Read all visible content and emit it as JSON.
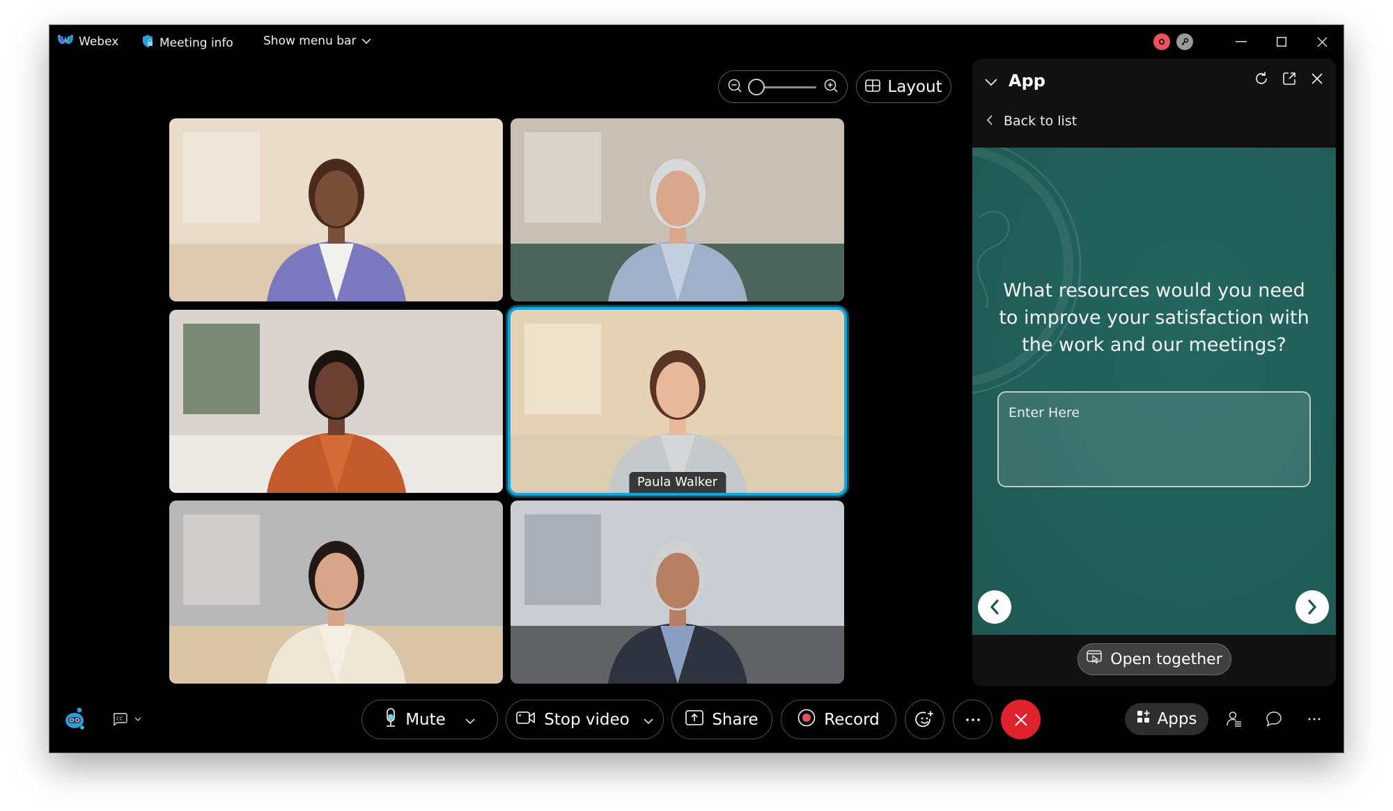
{
  "titlebar": {
    "app_name": "Webex",
    "meeting_info": "Meeting info",
    "show_menu_bar": "Show menu bar",
    "status_icons": [
      "recording-indicator-icon",
      "key-icon"
    ],
    "window_controls": [
      "minimize",
      "maximize",
      "close"
    ]
  },
  "stage": {
    "zoom_slider": {
      "value_fraction": 0.0
    },
    "layout_label": "Layout"
  },
  "participants": [
    {
      "name": "",
      "active": false,
      "scene": "bedroom"
    },
    {
      "name": "",
      "active": false,
      "scene": "living-room"
    },
    {
      "name": "",
      "active": false,
      "scene": "home-office"
    },
    {
      "name": "Paula Walker",
      "active": true,
      "scene": "bright-room"
    },
    {
      "name": "",
      "active": false,
      "scene": "kitchen"
    },
    {
      "name": "",
      "active": false,
      "scene": "rooftop-city"
    }
  ],
  "panel": {
    "title": "App",
    "back_label": "Back to list",
    "question": "What resources would you need to improve your satisfaction with the work and our meetings?",
    "answer_placeholder": "Enter Here",
    "answer_value": "",
    "open_together_label": "Open together"
  },
  "toolbar": {
    "mute_label": "Mute",
    "stop_video_label": "Stop video",
    "share_label": "Share",
    "record_label": "Record",
    "apps_label": "Apps"
  },
  "colors": {
    "accent_active": "#14a5d9",
    "end_call": "#e0222d",
    "record_dot": "#e8505b",
    "panel_teal": "#215e58",
    "status_red": "#f0525a"
  }
}
